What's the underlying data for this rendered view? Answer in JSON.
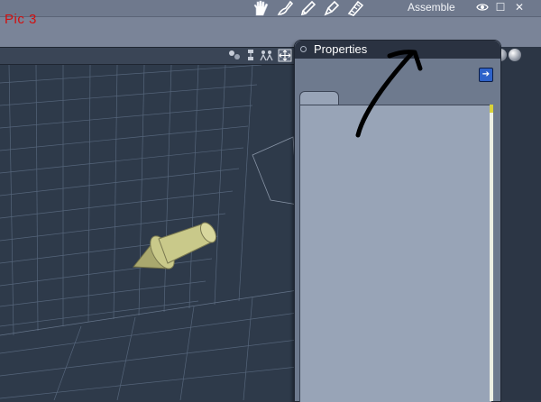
{
  "annotation_label": "Pic 3",
  "menubar": {
    "room_label": "Assemble",
    "tool_icons": [
      "pose-hand-icon",
      "brush-icon",
      "pencil-icon",
      "pen-icon",
      "film-icon"
    ],
    "window_controls": [
      "eye-icon",
      "maximize-icon",
      "close-icon"
    ],
    "close_glyph": "✕",
    "maximize_glyph": "☐"
  },
  "viewport": {
    "toolbar_icons": [
      "camera-icon",
      "hierarchy-icon",
      "figure-icon",
      "move-icon"
    ],
    "object": "3D arrow primitive"
  },
  "properties_panel": {
    "title": "Properties",
    "expand_glyph": "➔"
  },
  "colors": {
    "menubar": "#7a8498",
    "viewport_bg": "#2e3a4a",
    "panel_bg": "#6e7a8e",
    "panel_body": "#98a4b7",
    "annotation_red": "#d10f0f",
    "object_fill": "#c9c98a"
  }
}
